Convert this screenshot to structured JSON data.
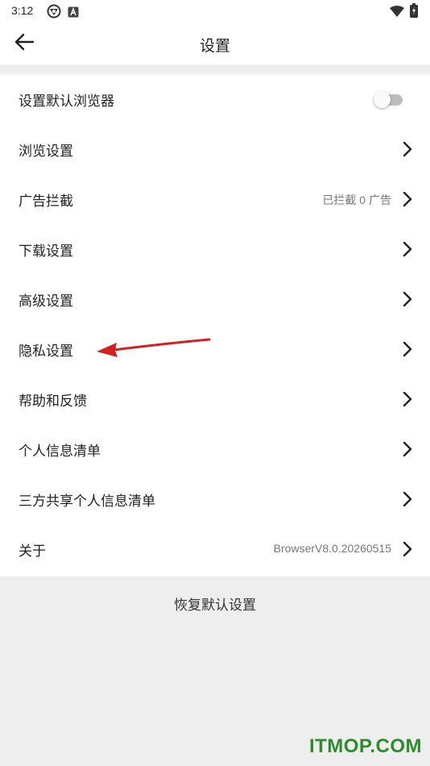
{
  "status_bar": {
    "time": "3:12",
    "left_icons": [
      "sync-icon",
      "app-a-icon"
    ],
    "right_icons": [
      "wifi-icon",
      "battery-charging-icon"
    ]
  },
  "app_bar": {
    "back_icon": "arrow-left-icon",
    "title": "设置"
  },
  "settings": {
    "default_browser": {
      "label": "设置默认浏览器",
      "toggle_on": false
    },
    "items": [
      {
        "label": "浏览设置",
        "value": ""
      },
      {
        "label": "广告拦截",
        "value": "已拦截 0 广告"
      },
      {
        "label": "下载设置",
        "value": ""
      },
      {
        "label": "高级设置",
        "value": ""
      },
      {
        "label": "隐私设置",
        "value": ""
      },
      {
        "label": "帮助和反馈",
        "value": ""
      },
      {
        "label": "个人信息清单",
        "value": ""
      },
      {
        "label": "三方共享个人信息清单",
        "value": ""
      },
      {
        "label": "关于",
        "value": "BrowserV8.0.20260515"
      }
    ]
  },
  "restore_button": {
    "label": "恢复默认设置"
  },
  "annotation": {
    "color": "#d42020"
  },
  "watermark": {
    "text": "ITMOP.COM",
    "color": "#2e8b2e"
  },
  "colors": {
    "background": "#eeeeee",
    "surface": "#ffffff",
    "toggle_off_track": "#bdbdbd",
    "secondary_text": "#777777"
  }
}
